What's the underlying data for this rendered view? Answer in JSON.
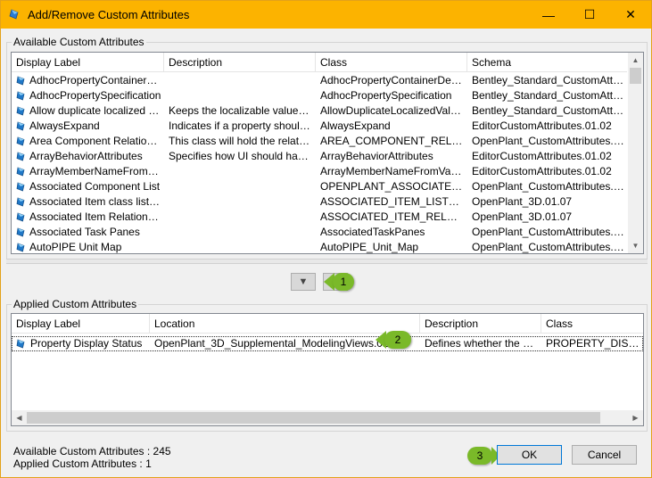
{
  "window": {
    "title": "Add/Remove Custom Attributes",
    "title_color": "#fcb300",
    "minimize_glyph": "—",
    "maximize_glyph": "☐",
    "close_glyph": "✕"
  },
  "available": {
    "group_label": "Available Custom Attributes",
    "columns": [
      "Display Label",
      "Description",
      "Class",
      "Schema"
    ],
    "rows": [
      {
        "label": "AdhocPropertyContainerDefi...",
        "description": "",
        "class": "AdhocPropertyContainerDefiniti...",
        "schema": "Bentley_Standard_CustomAttrib..."
      },
      {
        "label": "AdhocPropertySpecification",
        "description": "",
        "class": "AdhocPropertySpecification",
        "schema": "Bentley_Standard_CustomAttrib..."
      },
      {
        "label": "Allow duplicate localized val...",
        "description": "Keeps the localizable values fro...",
        "class": "AllowDuplicateLocalizedValues",
        "schema": "Bentley_Standard_CustomAttrib..."
      },
      {
        "label": "AlwaysExpand",
        "description": "Indicates if a property should al...",
        "class": "AlwaysExpand",
        "schema": "EditorCustomAttributes.01.02"
      },
      {
        "label": "Area Component Relationship",
        "description": "This class will hold the relations...",
        "class": "AREA_COMPONENT_RELATI...",
        "schema": "OpenPlant_CustomAttributes.0..."
      },
      {
        "label": "ArrayBehaviorAttributes",
        "description": "Specifies how UI should handle...",
        "class": "ArrayBehaviorAttributes",
        "schema": "EditorCustomAttributes.01.02"
      },
      {
        "label": "ArrayMemberNameFromValue",
        "description": "",
        "class": "ArrayMemberNameFromValue",
        "schema": "EditorCustomAttributes.01.02"
      },
      {
        "label": "Associated Component List",
        "description": "",
        "class": "OPENPLANT_ASSOCIATED_...",
        "schema": "OpenPlant_CustomAttributes.0..."
      },
      {
        "label": "Associated Item class list poi...",
        "description": "",
        "class": "ASSOCIATED_ITEM_LIST_P...",
        "schema": "OpenPlant_3D.01.07"
      },
      {
        "label": "Associated Item Relationship",
        "description": "",
        "class": "ASSOCIATED_ITEM_RELATI...",
        "schema": "OpenPlant_3D.01.07"
      },
      {
        "label": "Associated Task Panes",
        "description": "",
        "class": "AssociatedTaskPanes",
        "schema": "OpenPlant_CustomAttributes.0..."
      },
      {
        "label": "AutoPIPE Unit Map",
        "description": "",
        "class": "AutoPIPE_Unit_Map",
        "schema": "OpenPlant_CustomAttributes.0..."
      }
    ]
  },
  "move_buttons": {
    "down_glyph": "▼",
    "up_glyph": "▲"
  },
  "applied": {
    "group_label": "Applied Custom Attributes",
    "columns": [
      "Display Label",
      "Location",
      "Description",
      "Class"
    ],
    "sort_glyph": "^",
    "rows": [
      {
        "label": "Property Display Status",
        "location": "OpenPlant_3D_Supplemental_ModelingViews.01.07",
        "description": "Defines whether the wa...",
        "class": "PROPERTY_DISPLAY"
      }
    ]
  },
  "callouts": [
    {
      "number": "1",
      "color": "#7ab929"
    },
    {
      "number": "2",
      "color": "#7ab929"
    },
    {
      "number": "3",
      "color": "#7ab929"
    }
  ],
  "status": {
    "available_count_text": "Available Custom Attributes : 245",
    "applied_count_text": "Applied Custom Attributes : 1"
  },
  "buttons": {
    "ok": "OK",
    "cancel": "Cancel"
  },
  "icons": {
    "row_icon": "diamond-attribute-icon",
    "app_icon": "diamond-attribute-icon"
  }
}
